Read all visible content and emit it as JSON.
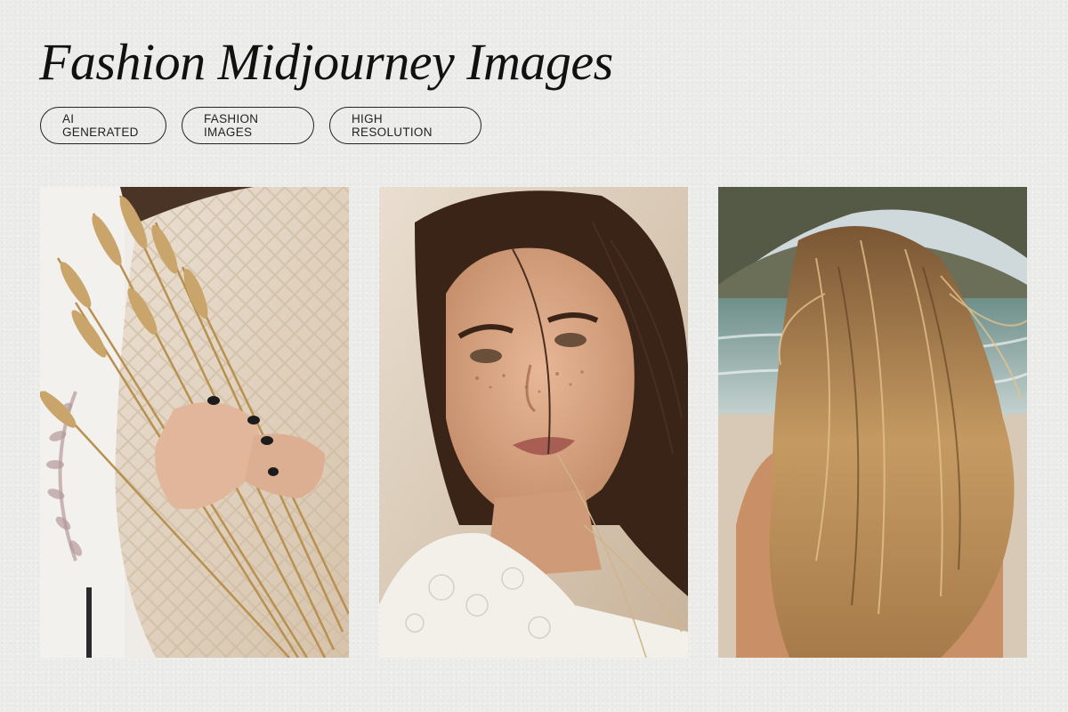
{
  "title": "Fashion Midjourney Images",
  "tags": [
    "AI GENERATED",
    "FASHION IMAGES",
    "HIGH RESOLUTION"
  ],
  "colors": {
    "background": "#ececea",
    "text": "#111111",
    "sweater": "#e3d2bd",
    "wheat": "#c9a367",
    "hair_blonde": "#b58a58",
    "hair_dark": "#3a2418",
    "sea": "#7fa7a6"
  }
}
